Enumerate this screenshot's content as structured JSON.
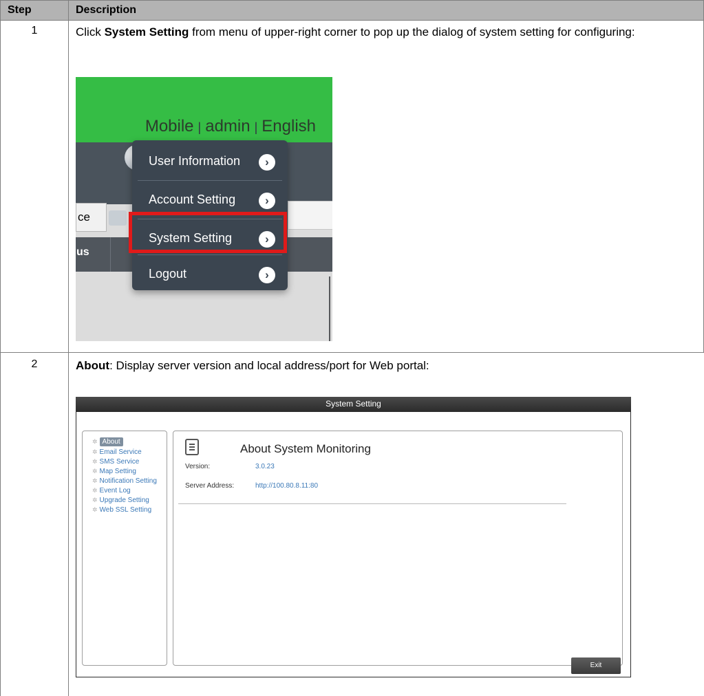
{
  "table": {
    "header_step": "Step",
    "header_description": "Description"
  },
  "rows": [
    {
      "step": "1",
      "bold": "System Setting",
      "text_before": "Click ",
      "text_after": " from menu of upper-right corner to pop up the dialog of system setting for configuring:"
    },
    {
      "step": "2",
      "bold": "About",
      "text_after": ": Display server version and local address/port for Web portal:"
    }
  ],
  "screenshot1": {
    "top_links": [
      "Mobile",
      "admin",
      "English"
    ],
    "top_separator": "|",
    "bubble_glyph": "!",
    "left_box_text": "ce",
    "row_text": "us",
    "menu_items": [
      "User Information",
      "Account Setting",
      "System Setting",
      "Logout"
    ],
    "highlighted_item": "System Setting",
    "accent_green": "#35bd45",
    "highlight_red": "#e01a1a"
  },
  "screenshot2": {
    "title": "System Setting",
    "nav_items": [
      "About",
      "Email Service",
      "SMS Service",
      "Map Setting",
      "Notification Setting",
      "Event Log",
      "Upgrade Setting",
      "Web SSL Setting"
    ],
    "active_nav": "About",
    "heading": "About System Monitoring",
    "version_label": "Version:",
    "version_value": "3.0.23",
    "server_label": "Server Address:",
    "server_value": "http://100.80.8.11:80",
    "exit_label": "Exit"
  }
}
